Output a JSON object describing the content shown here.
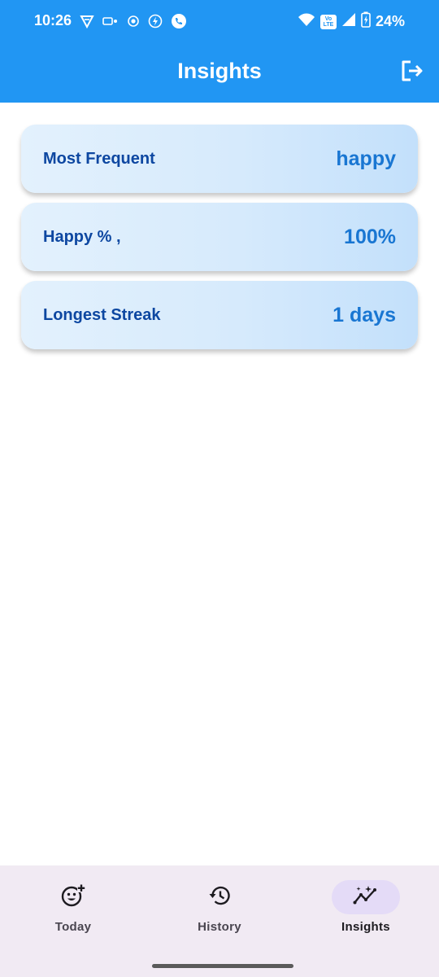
{
  "status_bar": {
    "time": "10:26",
    "battery_percent": "24%",
    "volte": "Vo LTE"
  },
  "app_bar": {
    "title": "Insights",
    "logout_icon": "logout-icon"
  },
  "cards": [
    {
      "label": "Most Frequent",
      "value": "happy"
    },
    {
      "label": "Happy % ,",
      "value": "100%"
    },
    {
      "label": "Longest Streak",
      "value": "1 days"
    }
  ],
  "bottom_nav": {
    "items": [
      {
        "label": "Today",
        "icon": "add-reaction-icon",
        "active": false
      },
      {
        "label": "History",
        "icon": "history-icon",
        "active": false
      },
      {
        "label": "Insights",
        "icon": "insights-icon",
        "active": true
      }
    ]
  },
  "colors": {
    "primary": "#2196F3",
    "card_label": "#0D47A1",
    "card_value": "#1976D2",
    "nav_bg": "#f1eaf3",
    "nav_active_pill": "#e4dbf7"
  }
}
